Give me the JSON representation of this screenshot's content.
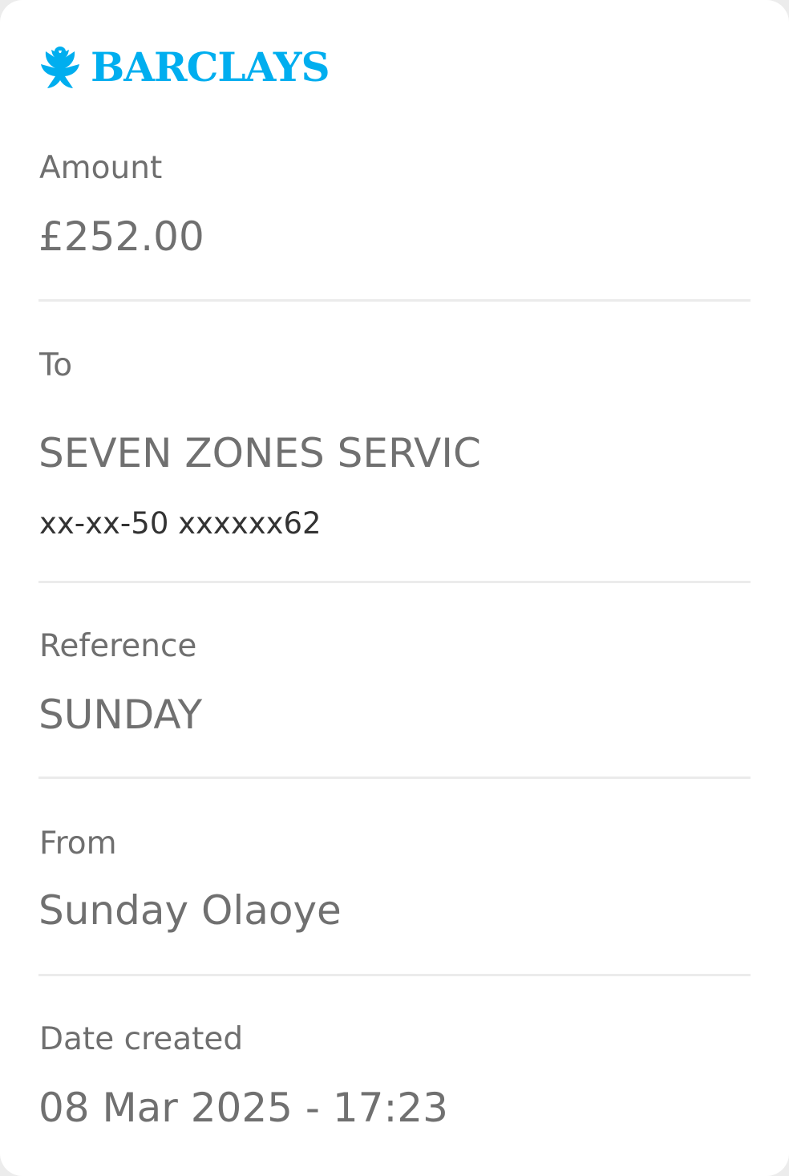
{
  "brand": {
    "name": "BARCLAYS",
    "logo_icon": "eagle-icon",
    "color": "#00aeef"
  },
  "amount": {
    "label": "Amount",
    "value": "£252.00"
  },
  "to": {
    "label": "To",
    "name": "SEVEN ZONES SERVIC",
    "account": "xx-xx-50 xxxxxx62"
  },
  "reference": {
    "label": "Reference",
    "value": "SUNDAY"
  },
  "from": {
    "label": "From",
    "value": "Sunday Olaoye"
  },
  "date_created": {
    "label": "Date created",
    "value": "08 Mar 2025 - 17:23"
  }
}
